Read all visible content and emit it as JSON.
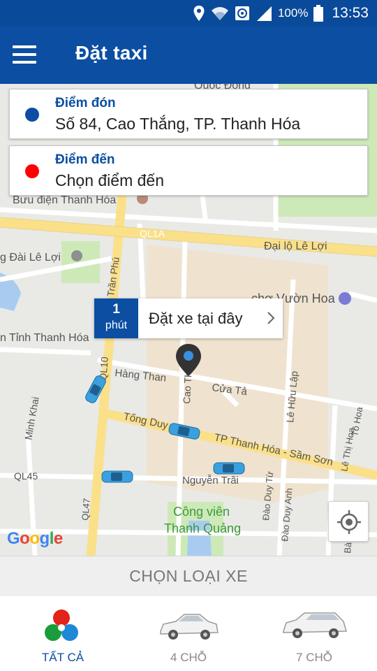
{
  "status_bar": {
    "battery_percent": "100%",
    "time": "13:53",
    "icons": [
      "location-icon",
      "wifi-icon",
      "sync-icon",
      "signal-icon",
      "battery-icon"
    ]
  },
  "app_bar": {
    "title": "Đặt taxi",
    "menu_icon": "hamburger-menu-icon"
  },
  "pickup": {
    "label": "Điểm đón",
    "value": "Số 84, Cao Thắng, TP. Thanh Hóa",
    "dot_color": "#0b4ea2"
  },
  "destination": {
    "label": "Điểm đến",
    "value": "Chọn điểm đến",
    "dot_color": "#ff0000"
  },
  "booking_bubble": {
    "eta_value": "1",
    "eta_unit": "phút",
    "text": "Đặt xe tại đây",
    "chevron_icon": "chevron-right-icon"
  },
  "map": {
    "labels": {
      "buu_dien": "Bưu điện Thanh Hóa",
      "ql1a": "QL1A",
      "dai_lo_le_loi": "Đại lộ Lê Lợi",
      "den_dai_le_loi": "g Đài Lê Lợi",
      "tran_phu": "Trần Phú",
      "cho_vuon_hoa": "chợ Vườn Hoa",
      "tinh_thanh_hoa": "n Tỉnh Thanh Hóa",
      "ql10": "QL10",
      "hang_than": "Hàng Than",
      "cao_thang": "Cao Th",
      "cua_ta": "Cửa Tả",
      "le_huu_lap": "Lê Hữu Lập",
      "to_hoa": "Tô Hoa",
      "minh_khai": "Minh Khai",
      "tong_duy_tan": "Tống Duy",
      "tp_thanh_hoa_sam_son": "TP Thanh Hóa - Sầm Sơn",
      "le_thi_hoa": "Lê Thị Hoa",
      "ql45": "QL45",
      "nguyen_trai": "Nguyễn Trãi",
      "ql47": "QL47",
      "dao_duy_tu": "Đào Duy Từ",
      "dao_duy_anh": "Đào Duy Anh",
      "cong_vien": "Công viên",
      "thanh_quang": "Thanh Quảng",
      "quoc_dong": "Quốc Đông",
      "ba": "Bà"
    },
    "google_logo": "Google",
    "locate_icon": "my-location-icon"
  },
  "choose_bar": {
    "label": "CHỌN LOẠI XE"
  },
  "vehicle_tabs": [
    {
      "label": "TẤT CẢ",
      "icon": "all-vehicles-icon",
      "active": true
    },
    {
      "label": "4 CHỖ",
      "icon": "car-4-seat-icon",
      "active": false
    },
    {
      "label": "7 CHỖ",
      "icon": "car-7-seat-icon",
      "active": false
    }
  ],
  "colors": {
    "primary": "#0b4ea2",
    "status_bar": "#0a4a9a",
    "taxi": "#3aa0e0"
  }
}
